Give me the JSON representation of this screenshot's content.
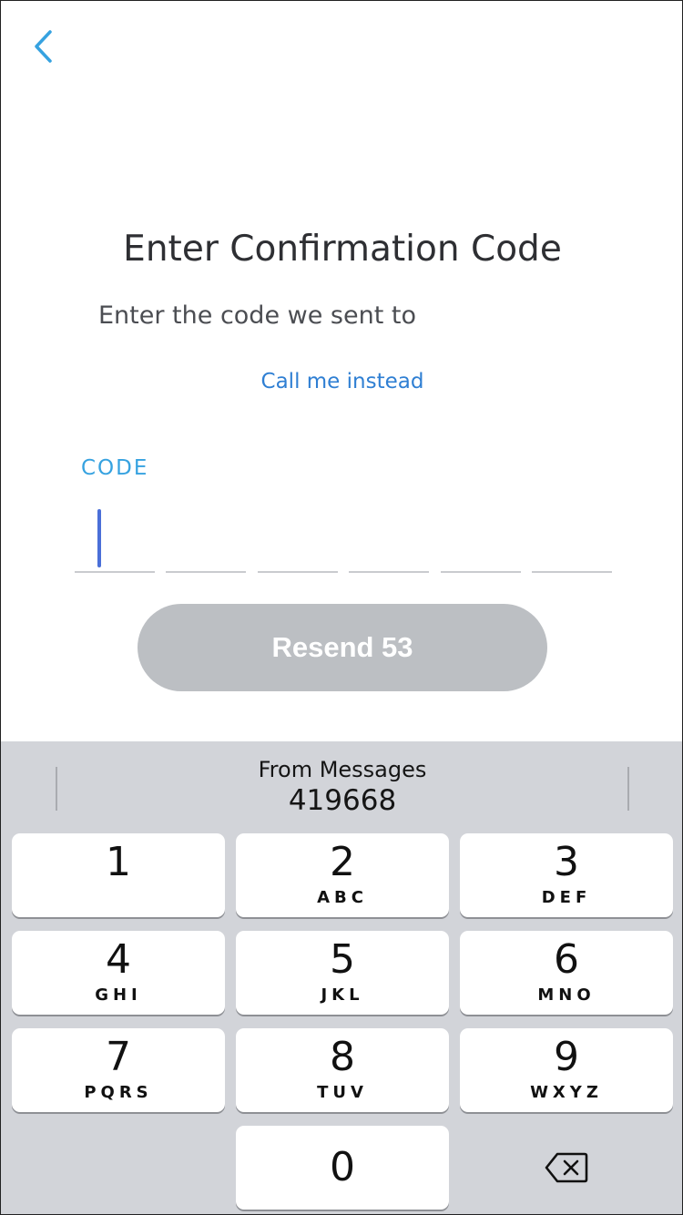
{
  "header": {
    "back_icon": "chevron-left-icon"
  },
  "main": {
    "title": "Enter Confirmation Code",
    "subtitle": "Enter the code we sent to",
    "call_link": "Call me instead",
    "code_label": "CODE",
    "code_digits": [
      "",
      "",
      "",
      "",
      "",
      ""
    ],
    "resend_label": "Resend 53"
  },
  "keyboard": {
    "suggestion": {
      "source": "From Messages",
      "code": "419668"
    },
    "keys": [
      {
        "digit": "1",
        "letters": ""
      },
      {
        "digit": "2",
        "letters": "ABC"
      },
      {
        "digit": "3",
        "letters": "DEF"
      },
      {
        "digit": "4",
        "letters": "GHI"
      },
      {
        "digit": "5",
        "letters": "JKL"
      },
      {
        "digit": "6",
        "letters": "MNO"
      },
      {
        "digit": "7",
        "letters": "PQRS"
      },
      {
        "digit": "8",
        "letters": "TUV"
      },
      {
        "digit": "9",
        "letters": "WXYZ"
      },
      {
        "digit": "0",
        "letters": ""
      }
    ],
    "delete_icon": "backspace-icon"
  },
  "colors": {
    "accent_blue": "#36a2e0",
    "link_blue": "#2f7fd3",
    "caret": "#4a6fd8",
    "button_disabled": "#bcbfc3",
    "keyboard_bg": "#d2d4d9"
  }
}
